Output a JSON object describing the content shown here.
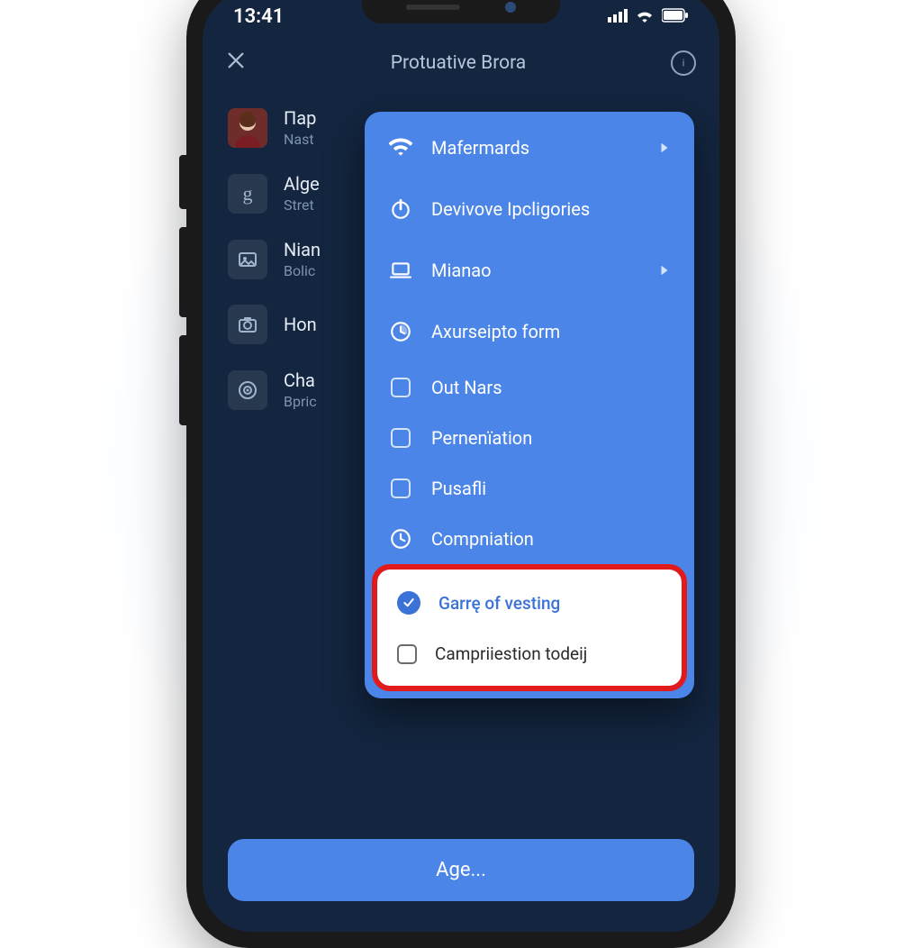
{
  "status": {
    "time": "13:41"
  },
  "header": {
    "title": "Protuative Brora"
  },
  "rows": [
    {
      "title": "Пар",
      "subtitle": "Nast"
    },
    {
      "title": "Alge",
      "subtitle": "Stret"
    },
    {
      "title": "Nian",
      "subtitle": "Bolic"
    },
    {
      "title": "Hon",
      "subtitle": ""
    },
    {
      "title": "Cha",
      "subtitle": "Bpric"
    }
  ],
  "menu": {
    "items": [
      {
        "label": "Mafermards",
        "icon": "wifi",
        "chevron": true
      },
      {
        "label": "Devivove Ipcligories",
        "icon": "power",
        "chevron": false
      },
      {
        "label": "Mianao",
        "icon": "laptop",
        "chevron": true
      },
      {
        "label": "Axurseipto form",
        "icon": "clock-partial",
        "chevron": false
      },
      {
        "label": "Out Nars",
        "icon": "checkbox",
        "chevron": false
      },
      {
        "label": "Pernenïation",
        "icon": "checkbox",
        "chevron": false
      },
      {
        "label": "Pusafli",
        "icon": "checkbox",
        "chevron": false
      },
      {
        "label": "Compniation",
        "icon": "clock",
        "chevron": false
      }
    ],
    "highlighted": [
      {
        "label": "Garrę of vesting",
        "checked": true
      },
      {
        "label": "Campriiestion todeij",
        "checked": false
      }
    ]
  },
  "footer": {
    "label": "Age..."
  }
}
